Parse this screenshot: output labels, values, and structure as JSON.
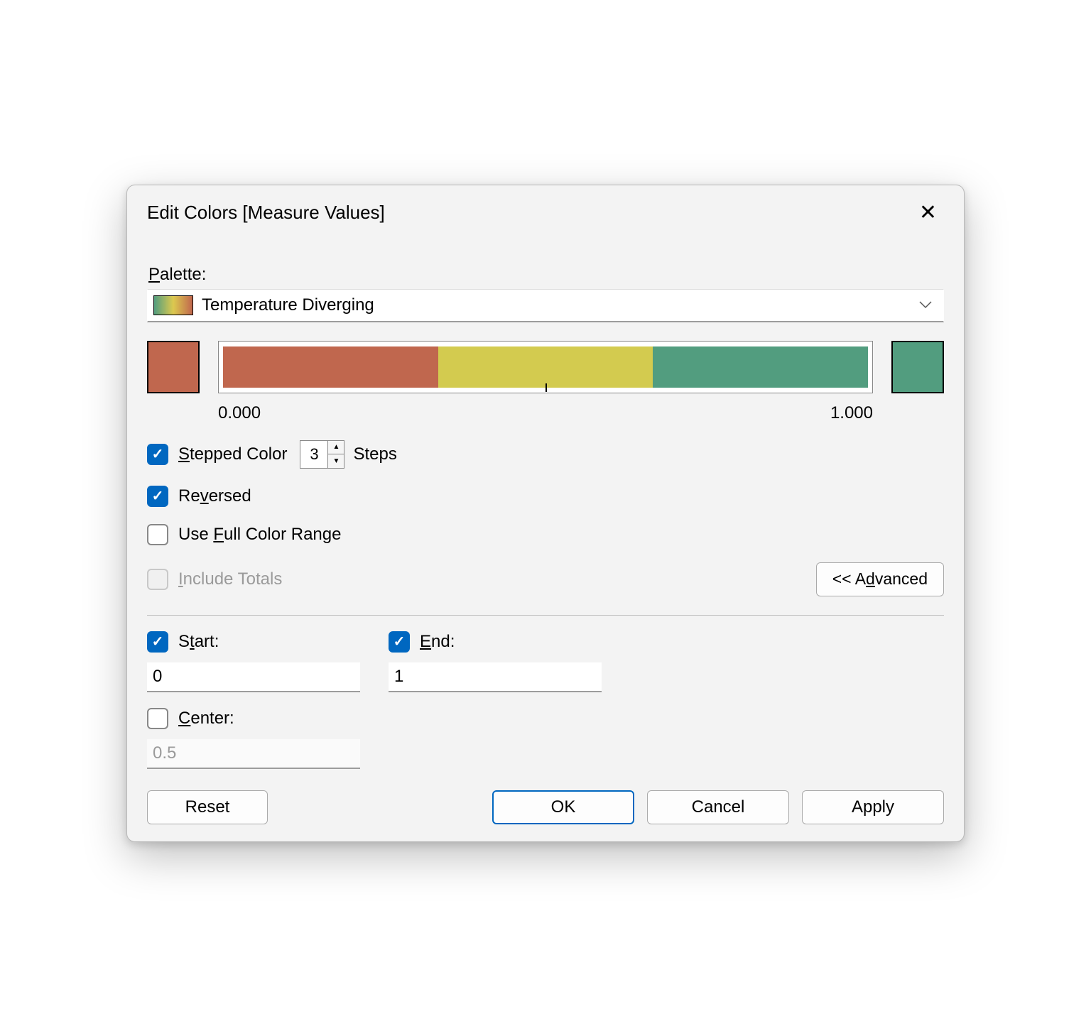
{
  "title": "Edit Colors [Measure Values]",
  "palette": {
    "label": "Palette:",
    "selected": "Temperature Diverging"
  },
  "ramp": {
    "start_swatch": "#c0674e",
    "end_swatch": "#529d7f",
    "segments": [
      "#c0674e",
      "#d3cb4f",
      "#529d7f"
    ],
    "min_label": "0.000",
    "max_label": "1.000"
  },
  "options": {
    "stepped_label_pre": "S",
    "stepped_label_post": "tepped Color",
    "stepped_checked": true,
    "steps_value": "3",
    "steps_suffix": "Steps",
    "reversed_pre": "Re",
    "reversed_u": "v",
    "reversed_post": "ersed",
    "reversed_checked": true,
    "full_range_pre": "Use ",
    "full_range_u": "F",
    "full_range_post": "ull Color Range",
    "full_range_checked": false,
    "include_totals_pre": "",
    "include_totals_u": "I",
    "include_totals_post": "nclude Totals",
    "include_totals_disabled": true,
    "advanced_pre": "<< A",
    "advanced_u": "d",
    "advanced_post": "vanced"
  },
  "range": {
    "start_label_pre": "S",
    "start_label_u": "t",
    "start_label_post": "art:",
    "start_checked": true,
    "start_value": "0",
    "end_label_u": "E",
    "end_label_post": "nd:",
    "end_checked": true,
    "end_value": "1",
    "center_label_u": "C",
    "center_label_post": "enter:",
    "center_checked": false,
    "center_value": "0.5"
  },
  "buttons": {
    "reset": "Reset",
    "ok": "OK",
    "cancel": "Cancel",
    "apply": "Apply"
  }
}
